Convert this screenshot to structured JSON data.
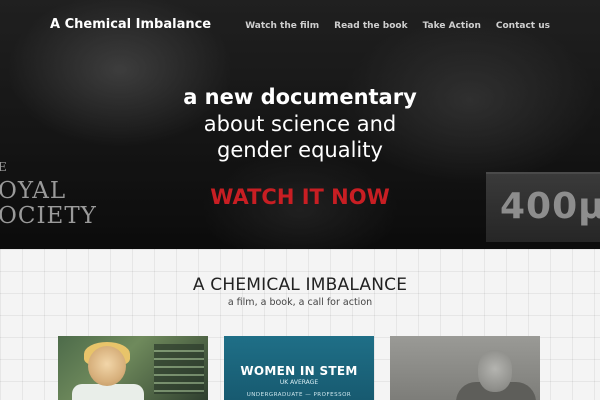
{
  "header": {
    "site_title": "A Chemical Imbalance",
    "nav": [
      "Watch the film",
      "Read the book",
      "Take Action",
      "Contact us"
    ]
  },
  "hero": {
    "headline_bold": "a new documentary",
    "headline_line2": "about science and",
    "headline_line3": "gender equality",
    "cta": "WATCH IT NOW",
    "background_text": {
      "society_line0": "E",
      "society_line1": "OYAL",
      "society_line2": "OCIETY",
      "plate": "400µ"
    }
  },
  "section": {
    "title": "A CHEMICAL IMBALANCE",
    "subtitle": "a film, a book, a call for action"
  },
  "cards": [
    {
      "name": "film-still"
    },
    {
      "title": "WOMEN IN STEM",
      "subtitle": "UK AVERAGE",
      "caption": "UNDERGRADUATE — PROFESSOR"
    },
    {
      "name": "portrait-photo"
    }
  ],
  "colors": {
    "cta": "#c81e23",
    "hero_bg": "#1b1b1b",
    "card_stem_bg": "#1f6f87"
  }
}
